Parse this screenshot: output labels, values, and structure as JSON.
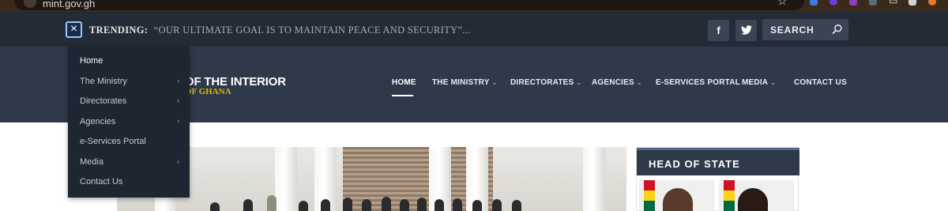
{
  "browser": {
    "url": "mint.gov.gh"
  },
  "top_bar": {
    "trending_label": "TRENDING:",
    "trending_text": "“OUR ULTIMATE GOAL IS TO MAINTAIN PEACE AND SECURITY”...",
    "social": [
      {
        "icon": "facebook-icon",
        "glyph": "f"
      },
      {
        "icon": "twitter-icon",
        "glyph": "t"
      }
    ],
    "search_label": "SEARCH"
  },
  "logo": {
    "main": "OF THE INTERIOR",
    "sub": "OF GHANA"
  },
  "nav": {
    "items": [
      {
        "label": "HOME",
        "has_dropdown": false,
        "active": true
      },
      {
        "label": "THE MINISTRY",
        "has_dropdown": true
      },
      {
        "label": "DIRECTORATES",
        "has_dropdown": true
      },
      {
        "label": "AGENCIES",
        "has_dropdown": true
      },
      {
        "label": "E-SERVICES PORTAL",
        "has_dropdown": false
      },
      {
        "label": "MEDIA",
        "has_dropdown": true
      },
      {
        "label": "CONTACT US",
        "has_dropdown": false
      }
    ]
  },
  "side_menu": {
    "items": [
      {
        "label": "Home",
        "has_submenu": false
      },
      {
        "label": "The Ministry",
        "has_submenu": true
      },
      {
        "label": "Directorates",
        "has_submenu": true
      },
      {
        "label": "Agencies",
        "has_submenu": true
      },
      {
        "label": "e-Services Portal",
        "has_submenu": false
      },
      {
        "label": "Media",
        "has_submenu": true
      },
      {
        "label": "Contact Us",
        "has_submenu": false
      }
    ]
  },
  "sidebar": {
    "head_of_state_title": "HEAD OF STATE"
  },
  "colors": {
    "top_bar": "#232b37",
    "header": "#2e3a4a",
    "dropdown": "#1e2632",
    "logo_sub": "#e0b40f"
  }
}
